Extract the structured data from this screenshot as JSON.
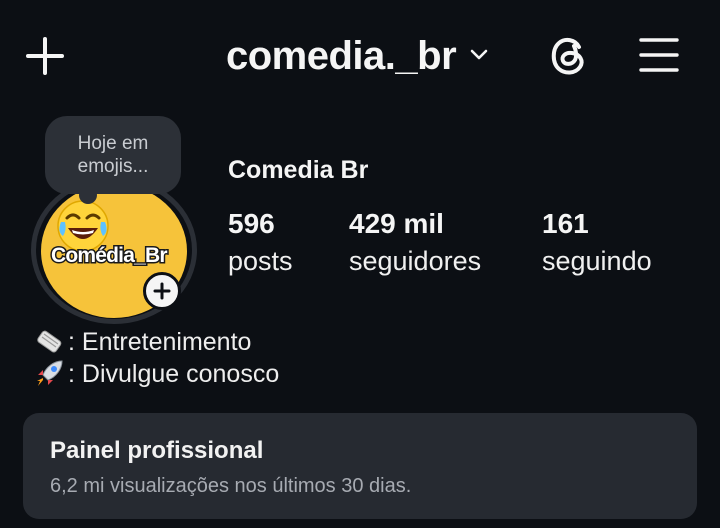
{
  "header": {
    "username": "comedia._br",
    "icons": [
      "plus-icon",
      "chevron-down-icon",
      "threads-icon",
      "hamburger-menu-icon"
    ]
  },
  "note": {
    "text": "Hoje em emojis..."
  },
  "profile": {
    "avatar_text": "Comédia_Br",
    "display_name": "Comedia Br",
    "stats": {
      "posts_value": "596",
      "posts_label": "posts",
      "followers_value": "429 mil",
      "followers_label": "seguidores",
      "following_value": "161",
      "following_label": "seguindo"
    }
  },
  "bio": {
    "line1": ": Entretenimento",
    "line1_icon": "newspaper-scroll-icon",
    "line2": ": Divulgue conosco",
    "line2_icon": "rocket-icon"
  },
  "dashboard": {
    "title": "Painel profissional",
    "subtitle": "6,2 mi visualizações nos últimos 30 dias."
  },
  "colors": {
    "background": "#0c0f14",
    "card": "#262a31",
    "avatar_yellow": "#f6c33a",
    "note_bubble": "#2c3037"
  }
}
